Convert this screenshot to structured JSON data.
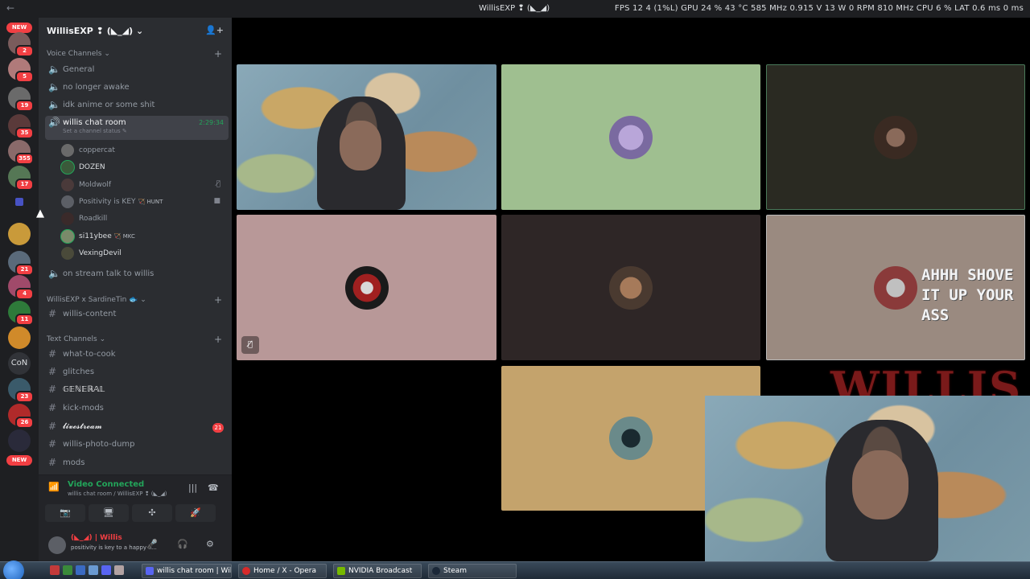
{
  "titlebar": {
    "back": "←",
    "title": "WillisEXP ❢ (◣_◢)",
    "stats": "FPS  12   4 (1%L)   GPU  24 %  43 °C  585 MHz  0.915 V  13 W  0 RPM  810 MHz   CPU  6 %   LAT  0.6 ms 0 ms"
  },
  "rail": {
    "new_top": "NEW",
    "new_bottom": "NEW",
    "con": "CoN",
    "badges": [
      "2",
      "5",
      "19",
      "35",
      "355",
      "17",
      "21",
      "4",
      "11",
      "23",
      "26"
    ]
  },
  "guild": {
    "name": "WillisEXP ❢ (◣_◢)",
    "chevron": "⌄",
    "invite_icon": "person-add-icon"
  },
  "voice": {
    "category": "Voice Channels",
    "channels": [
      "General",
      "no longer awake",
      "idk anime or some shit"
    ],
    "active": {
      "name": "willis chat room",
      "status": "Set a channel status ✎",
      "timer": "2:29:34"
    },
    "users": [
      {
        "name": "coppercat",
        "tag": ""
      },
      {
        "name": "DOZEN",
        "tag": ""
      },
      {
        "name": "Moldwolf",
        "tag": ""
      },
      {
        "name": "Positivity is KEY",
        "tag": "🏹 HUNT"
      },
      {
        "name": "Roadkill",
        "tag": ""
      },
      {
        "name": "si11ybee",
        "tag": "🏹 MKC"
      },
      {
        "name": "VexingDevil",
        "tag": ""
      }
    ],
    "extra": "on stream talk to willis"
  },
  "collab": {
    "category": "WillisEXP x SardineTin 🐟",
    "channel": "willis-content"
  },
  "text": {
    "category": "Text Channels",
    "channels": [
      "what-to-cook",
      "glitches",
      "𝔾𝔼ℕ𝔼ℝ𝔸𝕃",
      "kick-mods",
      "𝓵𝓲𝓿𝓮𝓼𝓽𝓻𝓮𝓪𝓶",
      "willis-photo-dump",
      "mods"
    ],
    "unread": "21"
  },
  "panel": {
    "video_connected": "Video Connected",
    "location": "willis chat room / WillisEXP ❢ (◣_◢)",
    "buttons": [
      "📷",
      "🖥",
      "✣",
      "🚀"
    ]
  },
  "me": {
    "name": "(◣_◢) | Willis",
    "status": "positivity is key to a happy li..."
  },
  "overlay": {
    "shove": "AHHH SHOVE IT UP YOUR ASS",
    "willis": "WILLIS"
  },
  "taskbar": {
    "tasks": [
      "willis chat room | Will...",
      "Home / X - Opera",
      "NVIDIA Broadcast",
      "Steam"
    ]
  },
  "colors": {
    "online": "#23a55a",
    "danger": "#f23f43",
    "sidebar": "#2b2d31"
  }
}
